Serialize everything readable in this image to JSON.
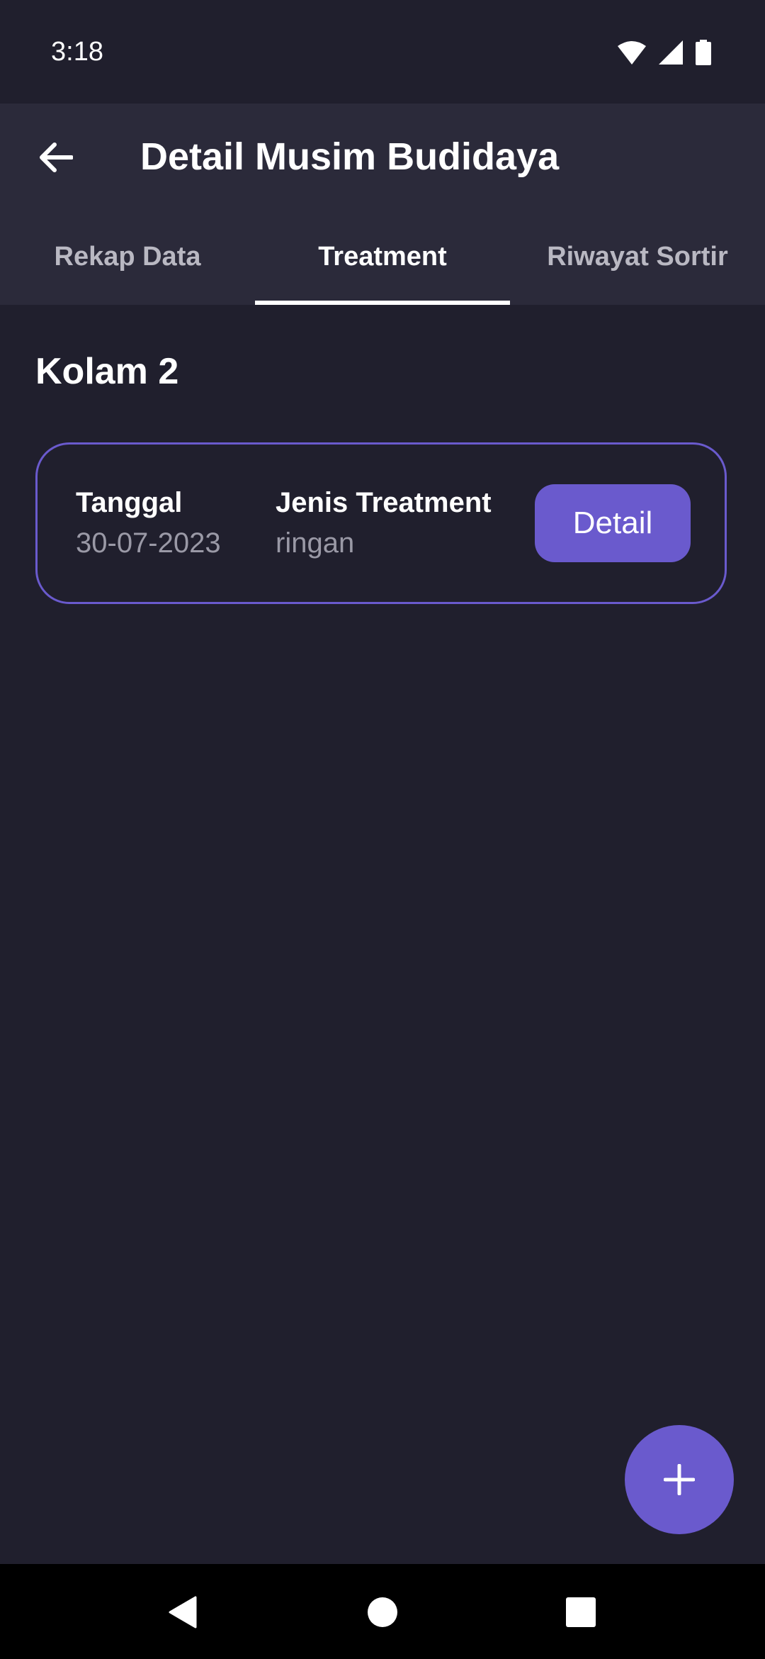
{
  "status_bar": {
    "time": "3:18",
    "icons": [
      "wifi-icon",
      "cellular-signal-icon",
      "battery-icon"
    ]
  },
  "app_bar": {
    "title": "Detail Musim Budidaya",
    "back_icon": "arrow-left-icon"
  },
  "tabs": [
    {
      "label": "Rekap Data",
      "active": false
    },
    {
      "label": "Treatment",
      "active": true
    },
    {
      "label": "Riwayat Sortir",
      "active": false
    }
  ],
  "section": {
    "title": "Kolam 2"
  },
  "treatments": [
    {
      "date_label": "Tanggal",
      "date_value": "30-07-2023",
      "type_label": "Jenis Treatment",
      "type_value": "ringan",
      "detail_label": "Detail"
    }
  ],
  "fab": {
    "icon": "plus-icon"
  },
  "navigation": {
    "icons": [
      "back-triangle-icon",
      "home-circle-icon",
      "recents-square-icon"
    ]
  },
  "colors": {
    "background": "#201f2d",
    "app_bar": "#2b2a3a",
    "accent": "#6a5acd",
    "muted_text": "#9a99a6"
  }
}
